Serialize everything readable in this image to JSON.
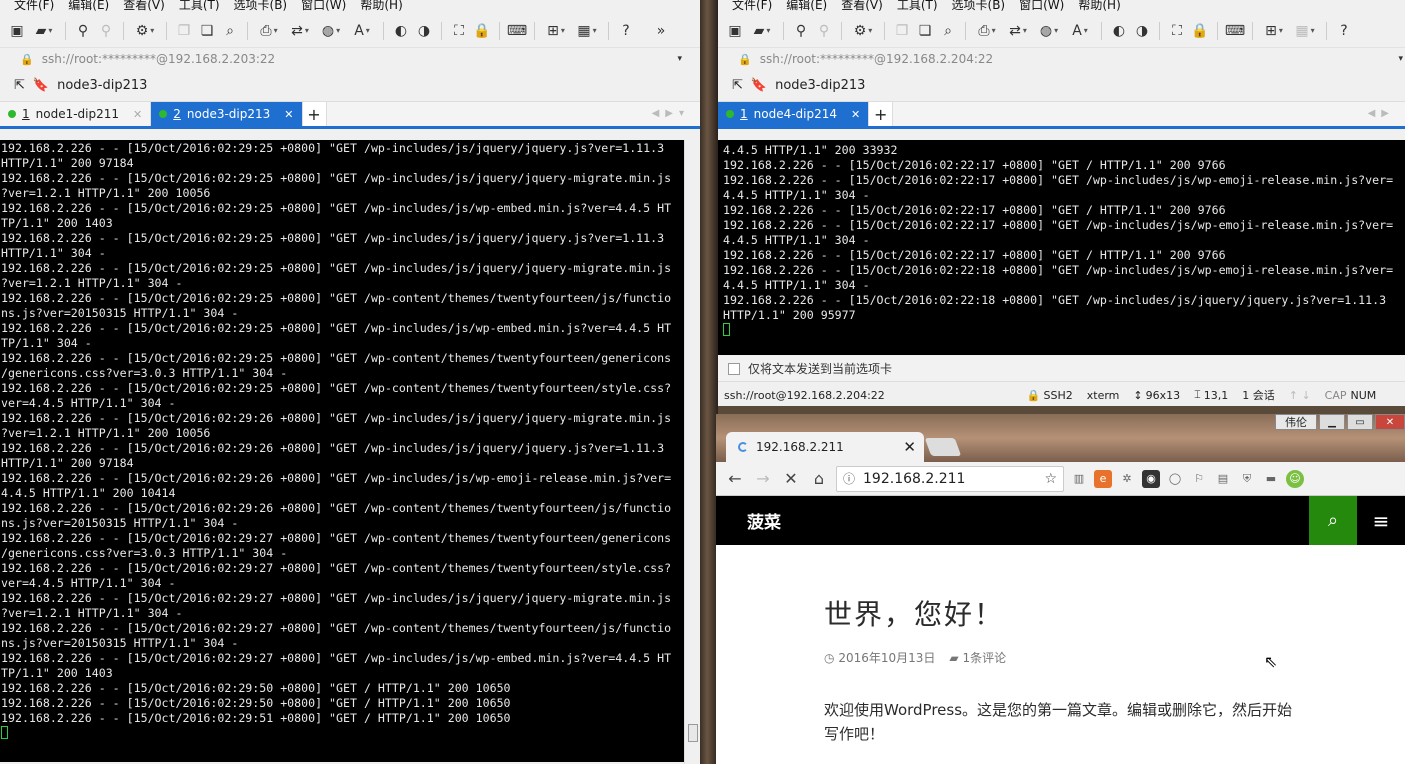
{
  "menu": [
    "文件(F)",
    "编辑(E)",
    "查看(V)",
    "工具(T)",
    "选项卡(B)",
    "窗口(W)",
    "帮助(H)"
  ],
  "left": {
    "address": "ssh://root:*********@192.168.2.203:22",
    "bookmark": "node3-dip213",
    "tabs": [
      {
        "num": "1",
        "label": "node1-dip211"
      },
      {
        "num": "2",
        "label": "node3-dip213"
      }
    ],
    "terminal_lines": [
      "192.168.2.226 - - [15/Oct/2016:02:29:25 +0800] \"GET /wp-includes/js/jquery/jquery.js?ver=1.11.3",
      "HTTP/1.1\" 200 97184",
      "192.168.2.226 - - [15/Oct/2016:02:29:25 +0800] \"GET /wp-includes/js/jquery/jquery-migrate.min.js",
      "?ver=1.2.1 HTTP/1.1\" 200 10056",
      "192.168.2.226 - - [15/Oct/2016:02:29:25 +0800] \"GET /wp-includes/js/wp-embed.min.js?ver=4.4.5 HT",
      "TP/1.1\" 200 1403",
      "192.168.2.226 - - [15/Oct/2016:02:29:25 +0800] \"GET /wp-includes/js/jquery/jquery.js?ver=1.11.3",
      "HTTP/1.1\" 304 -",
      "192.168.2.226 - - [15/Oct/2016:02:29:25 +0800] \"GET /wp-includes/js/jquery/jquery-migrate.min.js",
      "?ver=1.2.1 HTTP/1.1\" 304 -",
      "192.168.2.226 - - [15/Oct/2016:02:29:25 +0800] \"GET /wp-content/themes/twentyfourteen/js/functio",
      "ns.js?ver=20150315 HTTP/1.1\" 304 -",
      "192.168.2.226 - - [15/Oct/2016:02:29:25 +0800] \"GET /wp-includes/js/wp-embed.min.js?ver=4.4.5 HT",
      "TP/1.1\" 304 -",
      "192.168.2.226 - - [15/Oct/2016:02:29:25 +0800] \"GET /wp-content/themes/twentyfourteen/genericons",
      "/genericons.css?ver=3.0.3 HTTP/1.1\" 304 -",
      "192.168.2.226 - - [15/Oct/2016:02:29:25 +0800] \"GET /wp-content/themes/twentyfourteen/style.css?",
      "ver=4.4.5 HTTP/1.1\" 304 -",
      "192.168.2.226 - - [15/Oct/2016:02:29:26 +0800] \"GET /wp-includes/js/jquery/jquery-migrate.min.js",
      "?ver=1.2.1 HTTP/1.1\" 200 10056",
      "192.168.2.226 - - [15/Oct/2016:02:29:26 +0800] \"GET /wp-includes/js/jquery/jquery.js?ver=1.11.3",
      "HTTP/1.1\" 200 97184",
      "192.168.2.226 - - [15/Oct/2016:02:29:26 +0800] \"GET /wp-includes/js/wp-emoji-release.min.js?ver=",
      "4.4.5 HTTP/1.1\" 200 10414",
      "192.168.2.226 - - [15/Oct/2016:02:29:26 +0800] \"GET /wp-content/themes/twentyfourteen/js/functio",
      "ns.js?ver=20150315 HTTP/1.1\" 304 -",
      "192.168.2.226 - - [15/Oct/2016:02:29:27 +0800] \"GET /wp-content/themes/twentyfourteen/genericons",
      "/genericons.css?ver=3.0.3 HTTP/1.1\" 304 -",
      "192.168.2.226 - - [15/Oct/2016:02:29:27 +0800] \"GET /wp-content/themes/twentyfourteen/style.css?",
      "ver=4.4.5 HTTP/1.1\" 304 -",
      "192.168.2.226 - - [15/Oct/2016:02:29:27 +0800] \"GET /wp-includes/js/jquery/jquery-migrate.min.js",
      "?ver=1.2.1 HTTP/1.1\" 304 -",
      "192.168.2.226 - - [15/Oct/2016:02:29:27 +0800] \"GET /wp-content/themes/twentyfourteen/js/functio",
      "ns.js?ver=20150315 HTTP/1.1\" 304 -",
      "192.168.2.226 - - [15/Oct/2016:02:29:27 +0800] \"GET /wp-includes/js/wp-embed.min.js?ver=4.4.5 HT",
      "TP/1.1\" 200 1403",
      "192.168.2.226 - - [15/Oct/2016:02:29:50 +0800] \"GET / HTTP/1.1\" 200 10650",
      "192.168.2.226 - - [15/Oct/2016:02:29:50 +0800] \"GET / HTTP/1.1\" 200 10650",
      "192.168.2.226 - - [15/Oct/2016:02:29:51 +0800] \"GET / HTTP/1.1\" 200 10650"
    ]
  },
  "right": {
    "address": "ssh://root:*********@192.168.2.204:22",
    "bookmark": "node3-dip213",
    "tabs": [
      {
        "num": "1",
        "label": "node4-dip214"
      }
    ],
    "terminal_lines": [
      "4.4.5 HTTP/1.1\" 200 33932",
      "192.168.2.226 - - [15/Oct/2016:02:22:17 +0800] \"GET / HTTP/1.1\" 200 9766",
      "192.168.2.226 - - [15/Oct/2016:02:22:17 +0800] \"GET /wp-includes/js/wp-emoji-release.min.js?ver=",
      "4.4.5 HTTP/1.1\" 304 -",
      "192.168.2.226 - - [15/Oct/2016:02:22:17 +0800] \"GET / HTTP/1.1\" 200 9766",
      "192.168.2.226 - - [15/Oct/2016:02:22:17 +0800] \"GET /wp-includes/js/wp-emoji-release.min.js?ver=",
      "4.4.5 HTTP/1.1\" 304 -",
      "192.168.2.226 - - [15/Oct/2016:02:22:17 +0800] \"GET / HTTP/1.1\" 200 9766",
      "192.168.2.226 - - [15/Oct/2016:02:22:18 +0800] \"GET /wp-includes/js/wp-emoji-release.min.js?ver=",
      "4.4.5 HTTP/1.1\" 304 -",
      "192.168.2.226 - - [15/Oct/2016:02:22:18 +0800] \"GET /wp-includes/js/jquery/jquery.js?ver=1.11.3",
      "HTTP/1.1\" 200 95977"
    ],
    "send_bar": "仅将文本发送到当前选项卡",
    "status": {
      "conn": "ssh://root@192.168.2.204:22",
      "proto": "SSH2",
      "term": "xterm",
      "size": "96x13",
      "pos": "13,1",
      "sessions": "1 会话",
      "cap": "CAP",
      "num": "NUM"
    }
  },
  "browser": {
    "user_label": "伟伦",
    "tab_title": "192.168.2.211",
    "url": "192.168.2.211",
    "site_title": "菠菜",
    "post_title": "世界，您好！",
    "post_date": "2016年10月13日",
    "post_comments": "1条评论",
    "post_body": "欢迎使用WordPress。这是您的第一篇文章。编辑或删除它，然后开始写作吧！"
  },
  "colors": {
    "accent_tab": "#1e6fd0",
    "site_search": "#24890d",
    "terminal_bg": "#000000",
    "cursor": "#2ecc40"
  }
}
